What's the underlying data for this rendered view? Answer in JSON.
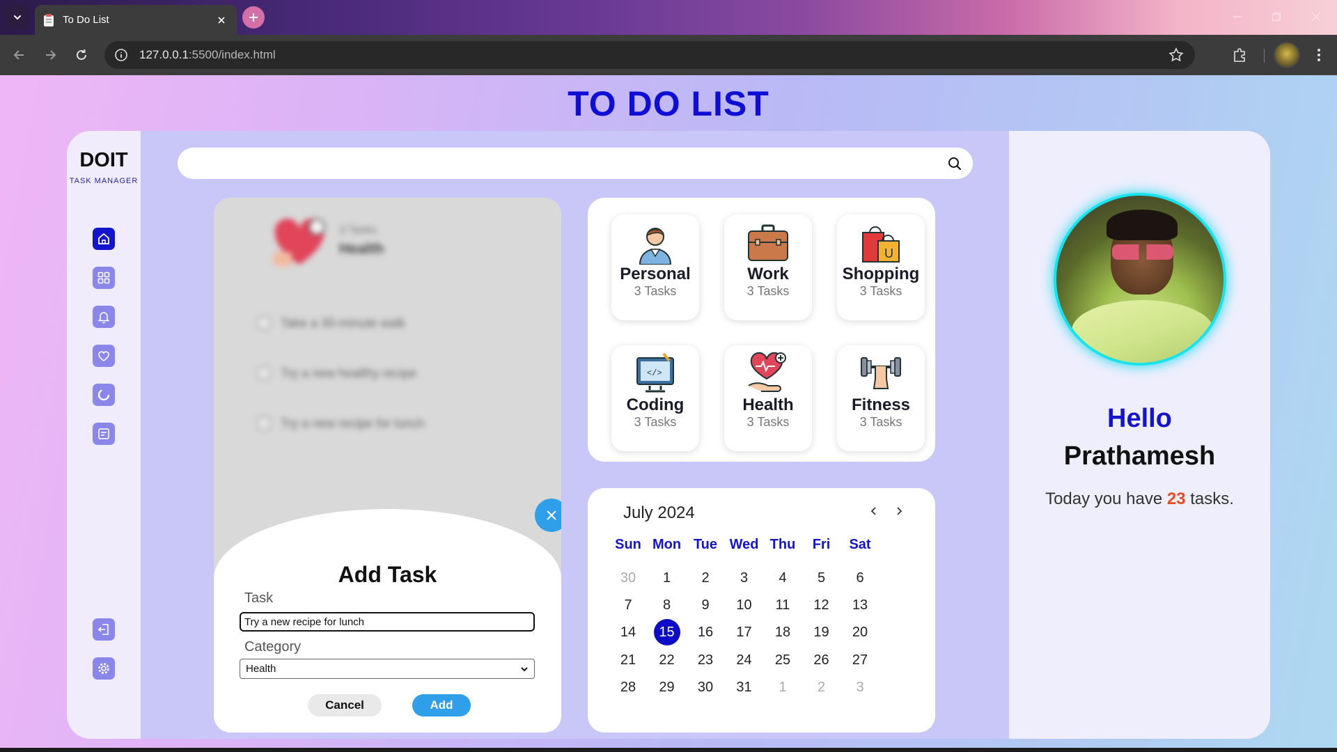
{
  "browser": {
    "tab_title": "To Do List",
    "url_host": "127.0.0.1",
    "url_rest": ":5500/index.html"
  },
  "page": {
    "title": "TO DO LIST"
  },
  "sidebar": {
    "brand": "DOIT",
    "brand_sub": "TASK MANAGER",
    "items": [
      {
        "icon": "home-icon",
        "active": true
      },
      {
        "icon": "grid-icon",
        "active": false
      },
      {
        "icon": "bell-icon",
        "active": false
      },
      {
        "icon": "heart-icon",
        "active": false
      },
      {
        "icon": "chart-icon",
        "active": false
      },
      {
        "icon": "notes-icon",
        "active": false
      }
    ],
    "bottom_items": [
      {
        "icon": "logout-icon"
      },
      {
        "icon": "settings-icon"
      }
    ]
  },
  "search": {
    "placeholder": "",
    "value": ""
  },
  "task_card": {
    "count": "3 Tasks",
    "category": "Health",
    "tasks": [
      {
        "text": "Take a 30-minute walk",
        "done": false
      },
      {
        "text": "Try a new healthy recipe",
        "done": false
      },
      {
        "text": "Try a new recipe for lunch",
        "done": false
      }
    ]
  },
  "add_task": {
    "title": "Add Task",
    "task_label": "Task",
    "task_value": "Try a new recipe for lunch",
    "category_label": "Category",
    "category_value": "Health",
    "cancel_label": "Cancel",
    "add_label": "Add"
  },
  "categories": [
    {
      "name": "Personal",
      "count": "3 Tasks",
      "icon": "person-icon"
    },
    {
      "name": "Work",
      "count": "3 Tasks",
      "icon": "briefcase-icon"
    },
    {
      "name": "Shopping",
      "count": "3 Tasks",
      "icon": "shopping-bags-icon"
    },
    {
      "name": "Coding",
      "count": "3 Tasks",
      "icon": "monitor-code-icon"
    },
    {
      "name": "Health",
      "count": "3 Tasks",
      "icon": "heart-hand-icon"
    },
    {
      "name": "Fitness",
      "count": "3 Tasks",
      "icon": "dumbbell-icon"
    }
  ],
  "calendar": {
    "month_label": "July 2024",
    "weekdays": [
      "Sun",
      "Mon",
      "Tue",
      "Wed",
      "Thu",
      "Fri",
      "Sat"
    ],
    "weeks": [
      [
        {
          "d": "30",
          "muted": true
        },
        {
          "d": "1"
        },
        {
          "d": "2"
        },
        {
          "d": "3"
        },
        {
          "d": "4"
        },
        {
          "d": "5"
        },
        {
          "d": "6"
        }
      ],
      [
        {
          "d": "7"
        },
        {
          "d": "8"
        },
        {
          "d": "9"
        },
        {
          "d": "10"
        },
        {
          "d": "11"
        },
        {
          "d": "12"
        },
        {
          "d": "13"
        }
      ],
      [
        {
          "d": "14"
        },
        {
          "d": "15",
          "today": true
        },
        {
          "d": "16"
        },
        {
          "d": "17"
        },
        {
          "d": "18"
        },
        {
          "d": "19"
        },
        {
          "d": "20"
        }
      ],
      [
        {
          "d": "21"
        },
        {
          "d": "22"
        },
        {
          "d": "23"
        },
        {
          "d": "24"
        },
        {
          "d": "25"
        },
        {
          "d": "26"
        },
        {
          "d": "27"
        }
      ],
      [
        {
          "d": "28"
        },
        {
          "d": "29"
        },
        {
          "d": "30"
        },
        {
          "d": "31"
        },
        {
          "d": "1",
          "muted": true
        },
        {
          "d": "2",
          "muted": true
        },
        {
          "d": "3",
          "muted": true
        }
      ]
    ]
  },
  "profile": {
    "greeting": "Hello",
    "name": "Prathamesh",
    "today_prefix": "Today you have",
    "task_count": "23",
    "today_suffix": "tasks."
  },
  "colors": {
    "accent_blue": "#1414cc",
    "fab_blue": "#2f9fe9",
    "highlight_orange": "#e84b1c",
    "avatar_ring": "#17e3ee"
  }
}
